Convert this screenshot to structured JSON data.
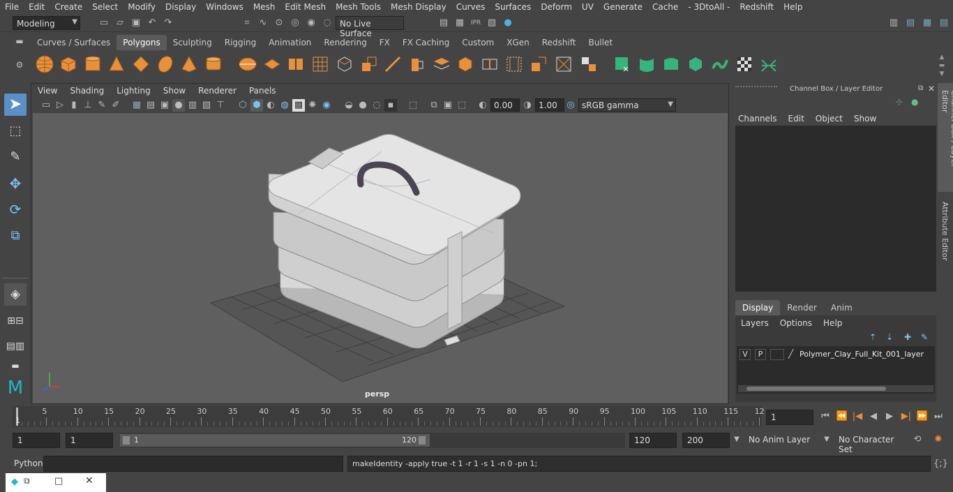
{
  "menubar": [
    "File",
    "Edit",
    "Create",
    "Select",
    "Modify",
    "Display",
    "Windows",
    "Mesh",
    "Edit Mesh",
    "Mesh Tools",
    "Mesh Display",
    "Curves",
    "Surfaces",
    "Deform",
    "UV",
    "Generate",
    "Cache",
    "- 3DtoAll -",
    "Redshift",
    "Help"
  ],
  "status": {
    "mode": "Modeling",
    "live_surface": "No Live Surface"
  },
  "shelf_tabs": [
    "Curves / Surfaces",
    "Polygons",
    "Sculpting",
    "Rigging",
    "Animation",
    "Rendering",
    "FX",
    "FX Caching",
    "Custom",
    "XGen",
    "Redshift",
    "Bullet"
  ],
  "shelf_active": "Polygons",
  "viewport": {
    "menu": [
      "View",
      "Shading",
      "Lighting",
      "Show",
      "Renderer",
      "Panels"
    ],
    "exposure": "0.00",
    "gamma": "1.00",
    "color_space": "sRGB gamma",
    "camera": "persp"
  },
  "channel_box": {
    "title": "Channel Box / Layer Editor",
    "menu": [
      "Channels",
      "Edit",
      "Object",
      "Show"
    ],
    "layer_tabs": [
      "Display",
      "Render",
      "Anim"
    ],
    "layer_menu": [
      "Layers",
      "Options",
      "Help"
    ],
    "layer": {
      "v": "V",
      "p": "P",
      "name": "Polymer_Clay_Full_Kit_001_layer"
    }
  },
  "side_tabs": [
    "Channel Box / Layer Editor",
    "Attribute Editor"
  ],
  "timeline": {
    "ticks": [
      "5",
      "10",
      "15",
      "20",
      "25",
      "30",
      "35",
      "40",
      "45",
      "50",
      "55",
      "60",
      "65",
      "70",
      "75",
      "80",
      "85",
      "90",
      "95",
      "100",
      "105",
      "110",
      "115",
      "12"
    ],
    "current_start": "1",
    "current_frame": "1"
  },
  "range": {
    "start": "1",
    "playback_start": "1",
    "slider_start": "1",
    "slider_end": "120",
    "playback_end": "120",
    "end": "200",
    "anim_layer": "No Anim Layer",
    "char_set": "No Character Set"
  },
  "cmd": {
    "lang": "Python",
    "output": "makeIdentity -apply true -t 1 -r 1 -s 1 -n 0 -pn 1;"
  },
  "colors": {
    "accent_shelf": "#e8913a",
    "green_shelf": "#37b37c",
    "active_tab": "#5a5a5a"
  }
}
